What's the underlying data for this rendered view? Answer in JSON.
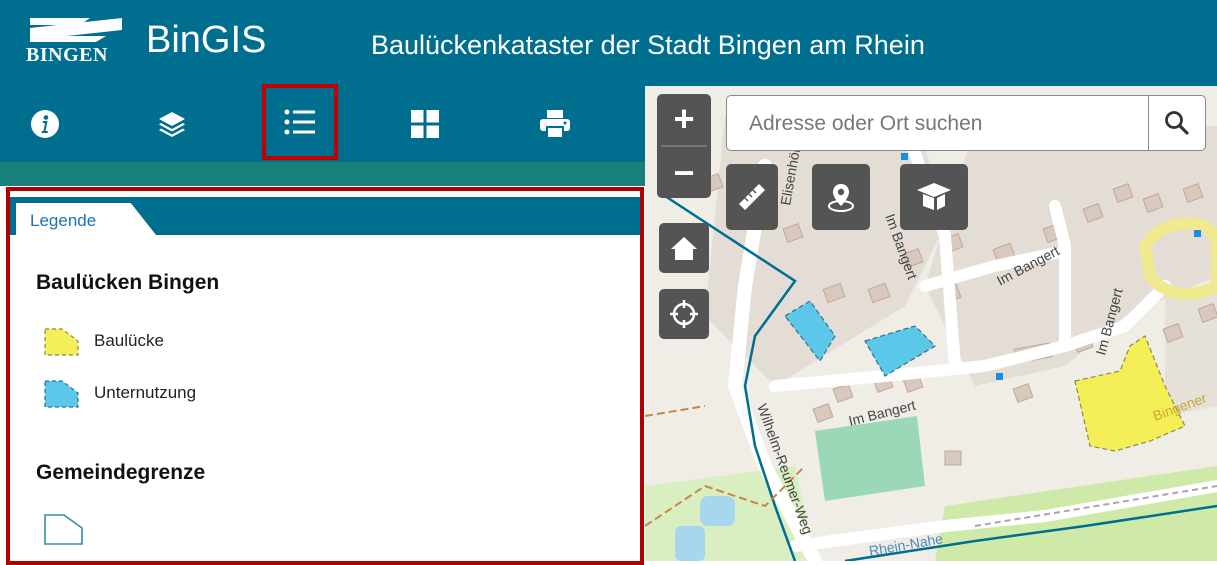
{
  "header": {
    "logo_text": "BINGEN",
    "app_name": "BinGIS",
    "subtitle": "Baulückenkataster der Stadt Bingen am Rhein"
  },
  "toolbar": {
    "items": [
      {
        "name": "info",
        "icon": "info-icon"
      },
      {
        "name": "layers",
        "icon": "layers-icon"
      },
      {
        "name": "legend",
        "icon": "list-icon",
        "active": true
      },
      {
        "name": "basemaps",
        "icon": "grid-icon"
      },
      {
        "name": "print",
        "icon": "printer-icon"
      }
    ]
  },
  "panel": {
    "tab_label": "Legende",
    "groups": [
      {
        "title": "Baulücken Bingen",
        "items": [
          {
            "label": "Baulücke",
            "color": "#f4ef57"
          },
          {
            "label": "Unternutzung",
            "color": "#5bc8ea"
          }
        ]
      },
      {
        "title": "Gemeindegrenze",
        "items": [
          {
            "label": "",
            "color": "#ffffff",
            "stroke": "#2f8fa8"
          }
        ]
      }
    ]
  },
  "map": {
    "search_placeholder": "Adresse oder Ort suchen",
    "zoom_in": "+",
    "zoom_out": "−",
    "street_labels": [
      "Elisenhöhe",
      "Im Bangert",
      "Im Bangert",
      "Im Bangert",
      "Im Bangert",
      "Wilhelm-Reumer-Weg",
      "Rhein-Nahe",
      "Bingener"
    ]
  },
  "colors": {
    "header": "#006e8f",
    "accent_red": "#c00000",
    "strip": "#197f7a",
    "map_button": "#545454"
  }
}
